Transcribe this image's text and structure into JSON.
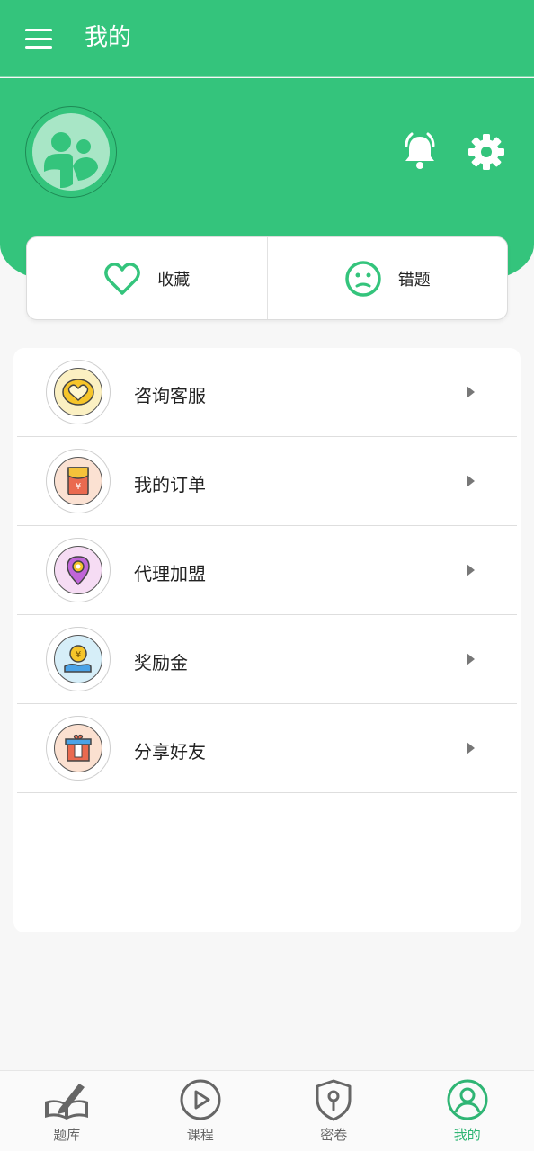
{
  "header": {
    "title": "我的"
  },
  "colors": {
    "primary": "#34c47c",
    "active_tab": "#2fb574"
  },
  "quick": [
    {
      "label": "收藏",
      "icon": "heart-icon"
    },
    {
      "label": "错题",
      "icon": "sad-face-icon"
    }
  ],
  "menu": [
    {
      "label": "咨询客服",
      "icon": "heart-chat-icon"
    },
    {
      "label": "我的订单",
      "icon": "red-envelope-icon"
    },
    {
      "label": "代理加盟",
      "icon": "location-pin-icon"
    },
    {
      "label": "奖励金",
      "icon": "coin-hand-icon"
    },
    {
      "label": "分享好友",
      "icon": "gift-icon"
    }
  ],
  "nav": [
    {
      "label": "题库",
      "icon": "book-pen-icon"
    },
    {
      "label": "课程",
      "icon": "play-icon"
    },
    {
      "label": "密卷",
      "icon": "shield-lock-icon"
    },
    {
      "label": "我的",
      "icon": "user-icon",
      "active": true
    }
  ]
}
